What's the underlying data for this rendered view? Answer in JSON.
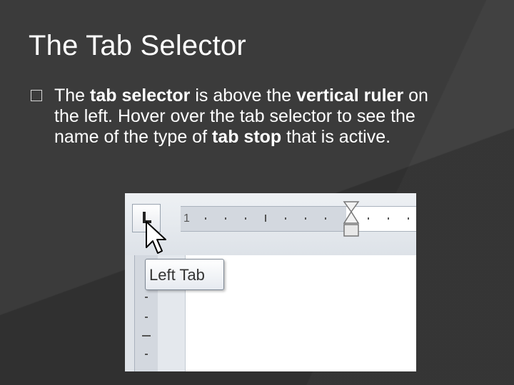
{
  "slide": {
    "title": "The Tab Selector",
    "bullet": {
      "t1": "The ",
      "b1": "tab selector",
      "t2": " is above the ",
      "b2": "vertical ruler",
      "t3": " on the left. Hover over the tab selector to see the name of the type of ",
      "b3": "tab stop",
      "t4": " that is active."
    }
  },
  "screenshot": {
    "tooltip_text": "Left Tab",
    "ruler_number": "1"
  },
  "colors": {
    "background": "#3b3b3b",
    "text": "#ffffff"
  }
}
